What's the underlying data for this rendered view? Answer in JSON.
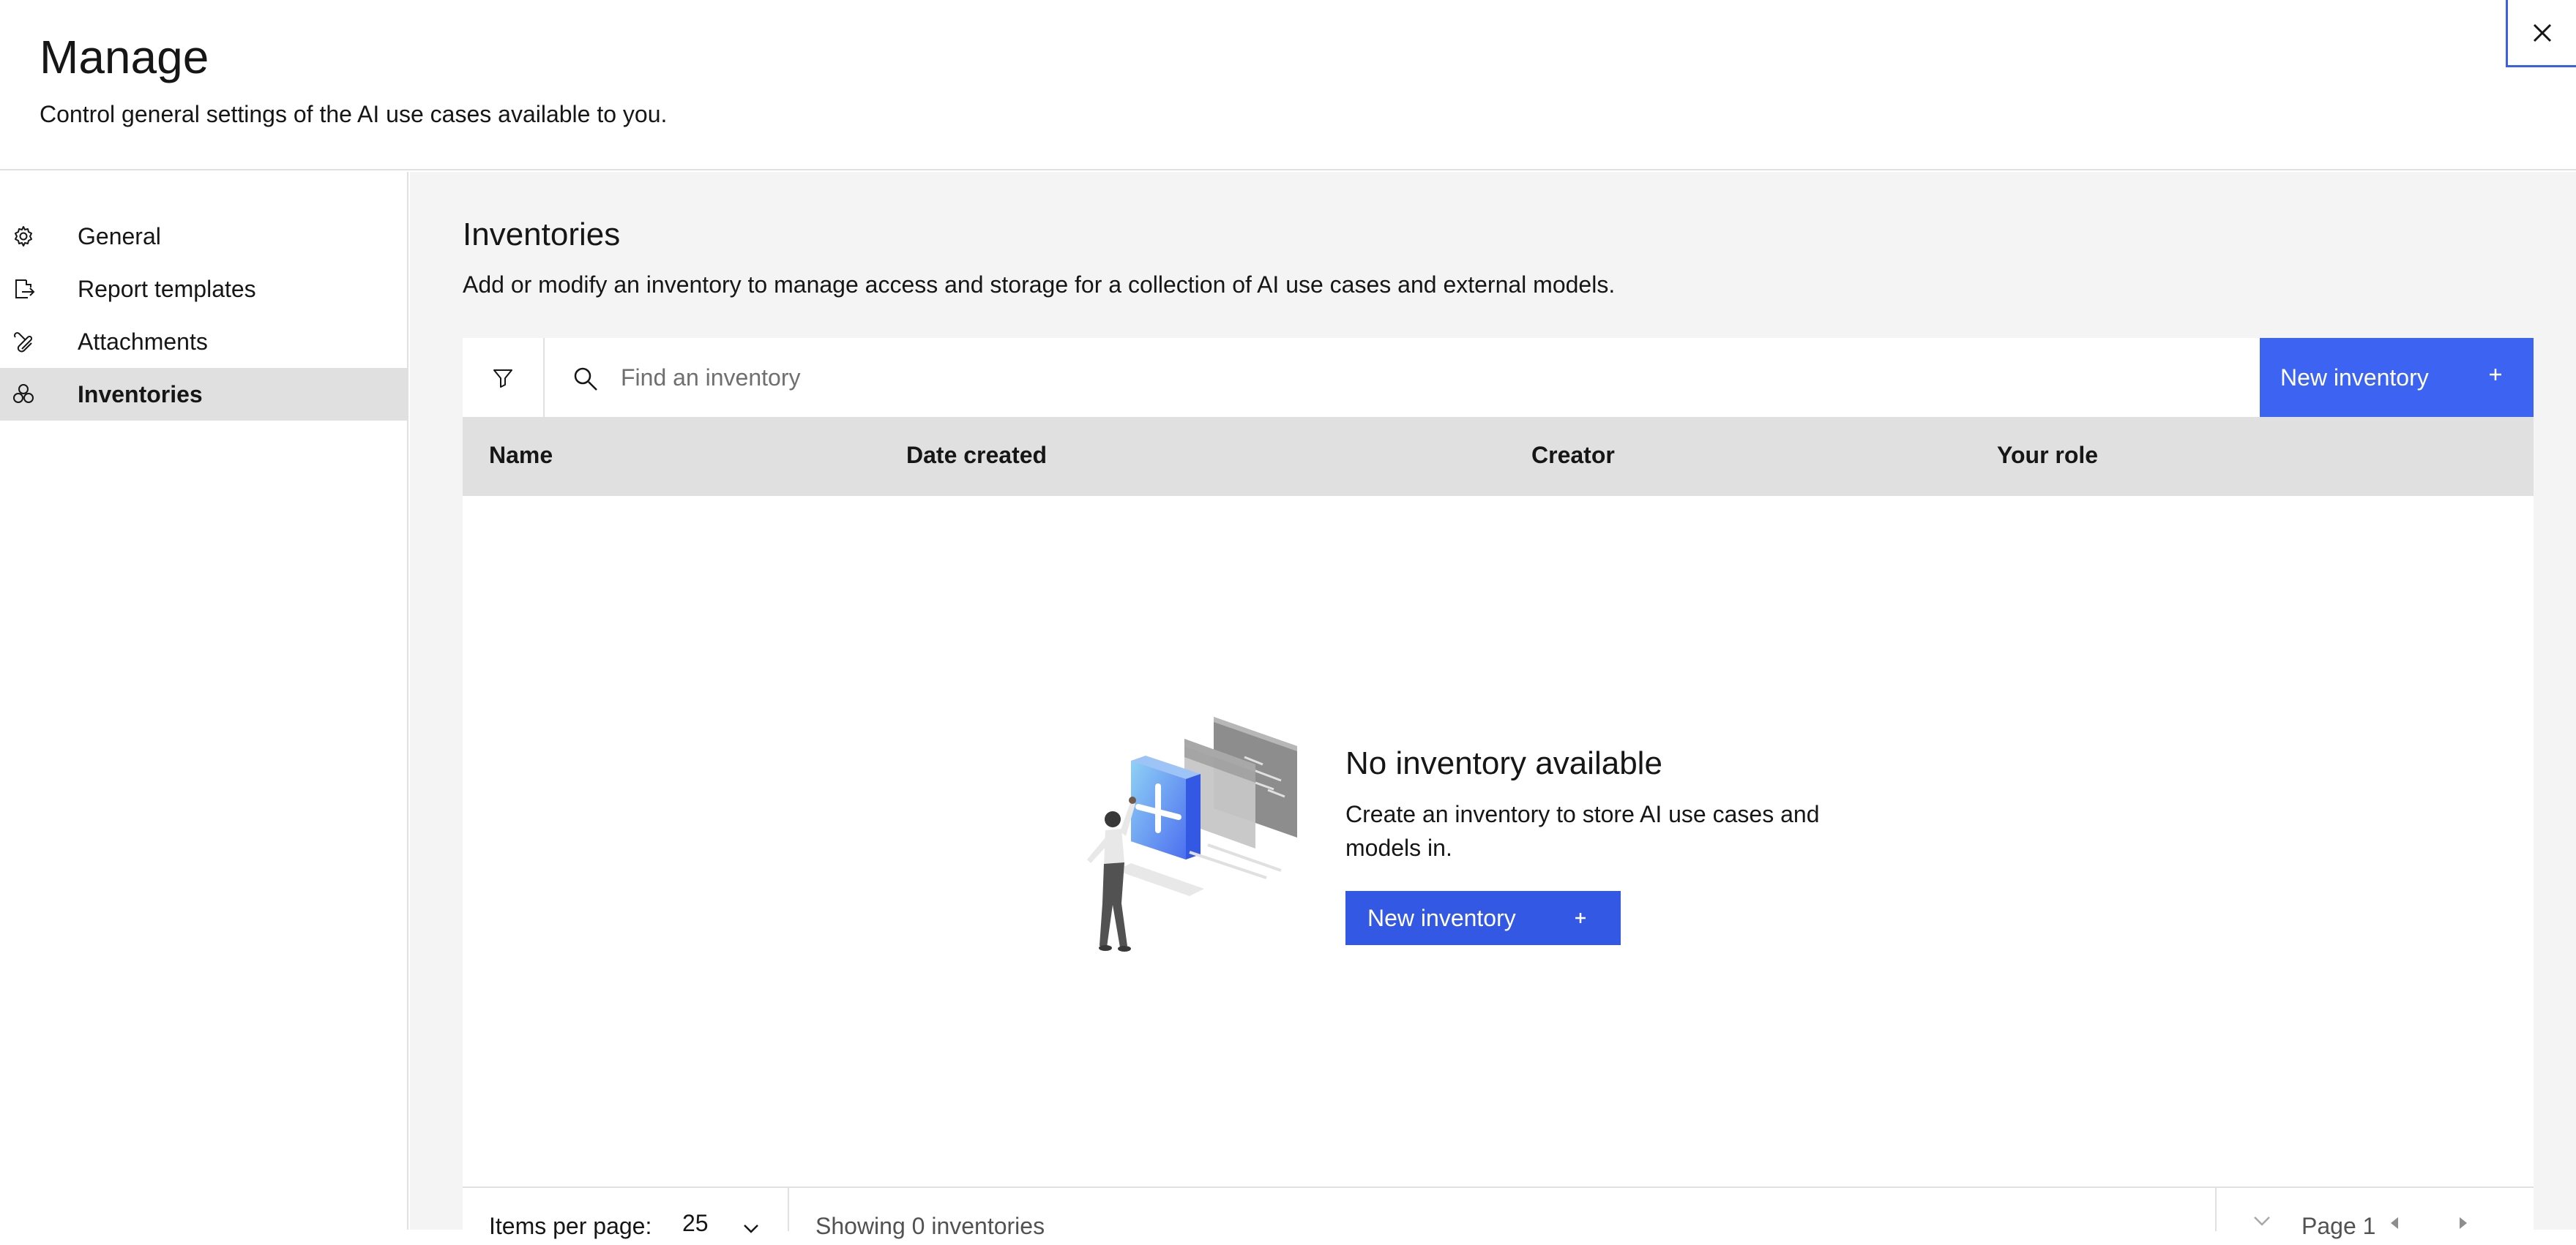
{
  "header": {
    "title": "Manage",
    "subtitle": "Control general settings of the AI use cases available to you."
  },
  "sidebar": {
    "items": [
      {
        "label": "General",
        "icon": "gear-icon"
      },
      {
        "label": "Report templates",
        "icon": "document-export-icon"
      },
      {
        "label": "Attachments",
        "icon": "paperclip-icon"
      },
      {
        "label": "Inventories",
        "icon": "inventory-icon",
        "active": true
      }
    ]
  },
  "main": {
    "title": "Inventories",
    "description": "Add or modify an inventory to manage access and storage for a collection of AI use cases and external models.",
    "search": {
      "placeholder": "Find an inventory"
    },
    "new_button": "New inventory",
    "columns": [
      "Name",
      "Date created",
      "Creator",
      "Your role"
    ],
    "empty_state": {
      "title": "No inventory available",
      "description": "Create an inventory to store AI use cases and models in.",
      "button": "New inventory"
    },
    "pagination": {
      "items_per_page_label": "Items per page:",
      "items_per_page_value": "25",
      "showing": "Showing 0 inventories",
      "page": "Page 1"
    }
  },
  "colors": {
    "primary": "#3d63f3",
    "button_mid": "#3358e4",
    "main_bg": "#f4f4f4",
    "table_header": "#e0e0e0"
  }
}
